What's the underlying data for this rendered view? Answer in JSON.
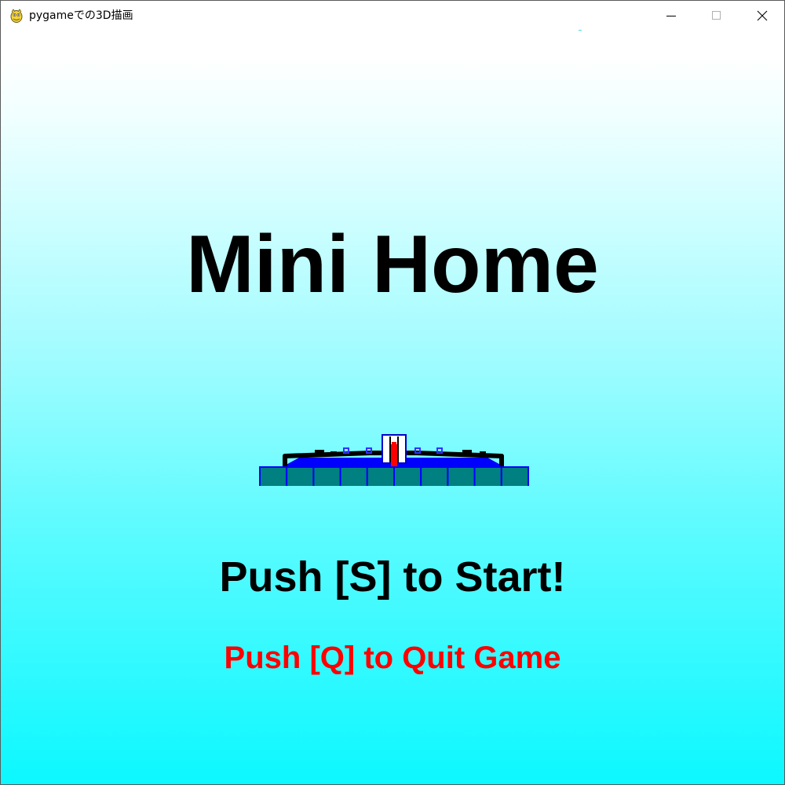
{
  "window": {
    "title": "pygameでの3D描画",
    "app_icon": "python-snake-icon",
    "controls": {
      "minimize_icon": "minimize-icon",
      "maximize_icon": "maximize-icon",
      "close_icon": "close-icon"
    }
  },
  "game": {
    "title": "Mini Home",
    "start_prompt": "Push [S] to Start!",
    "quit_prompt": "Push [Q] to Quit Game",
    "colors": {
      "title": "#000000",
      "start_prompt": "#000000",
      "quit_prompt": "#ff0000",
      "floor_tile": "#008080",
      "floor_outline": "#0000ff",
      "character": "#ff0000"
    }
  }
}
